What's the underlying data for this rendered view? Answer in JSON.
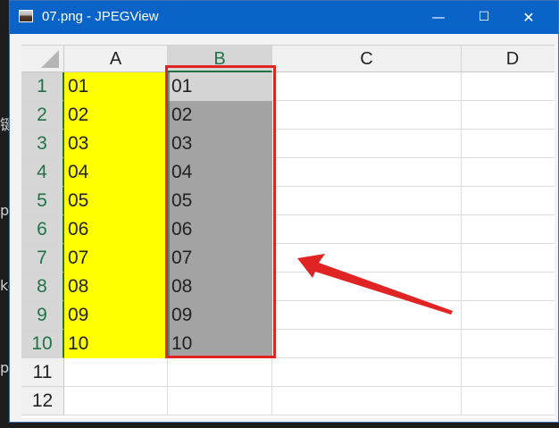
{
  "background_edge_texts": [
    "键",
    "pe",
    "ke",
    "p ("
  ],
  "window": {
    "title": "07.png - JPEGView",
    "icon": "image-icon",
    "controls": {
      "minimize": "—",
      "maximize": "☐",
      "close": "✕"
    }
  },
  "spreadsheet": {
    "columns": [
      "A",
      "B",
      "C",
      "D"
    ],
    "active_column": "B",
    "rows": [
      "1",
      "2",
      "3",
      "4",
      "5",
      "6",
      "7",
      "8",
      "9",
      "10",
      "11",
      "12"
    ],
    "column_a": [
      "01",
      "02",
      "03",
      "04",
      "05",
      "06",
      "07",
      "08",
      "09",
      "10"
    ],
    "column_b": [
      "01",
      "02",
      "03",
      "04",
      "05",
      "06",
      "07",
      "08",
      "09",
      "10"
    ],
    "fill_color_a": "#ffff00",
    "selection_color": "#a3a3a3",
    "selected_range": "B1:B10"
  },
  "annotation": {
    "box_color": "#e02424",
    "arrow_color": "#e02424",
    "arrow_icon": "red-arrow-icon"
  }
}
